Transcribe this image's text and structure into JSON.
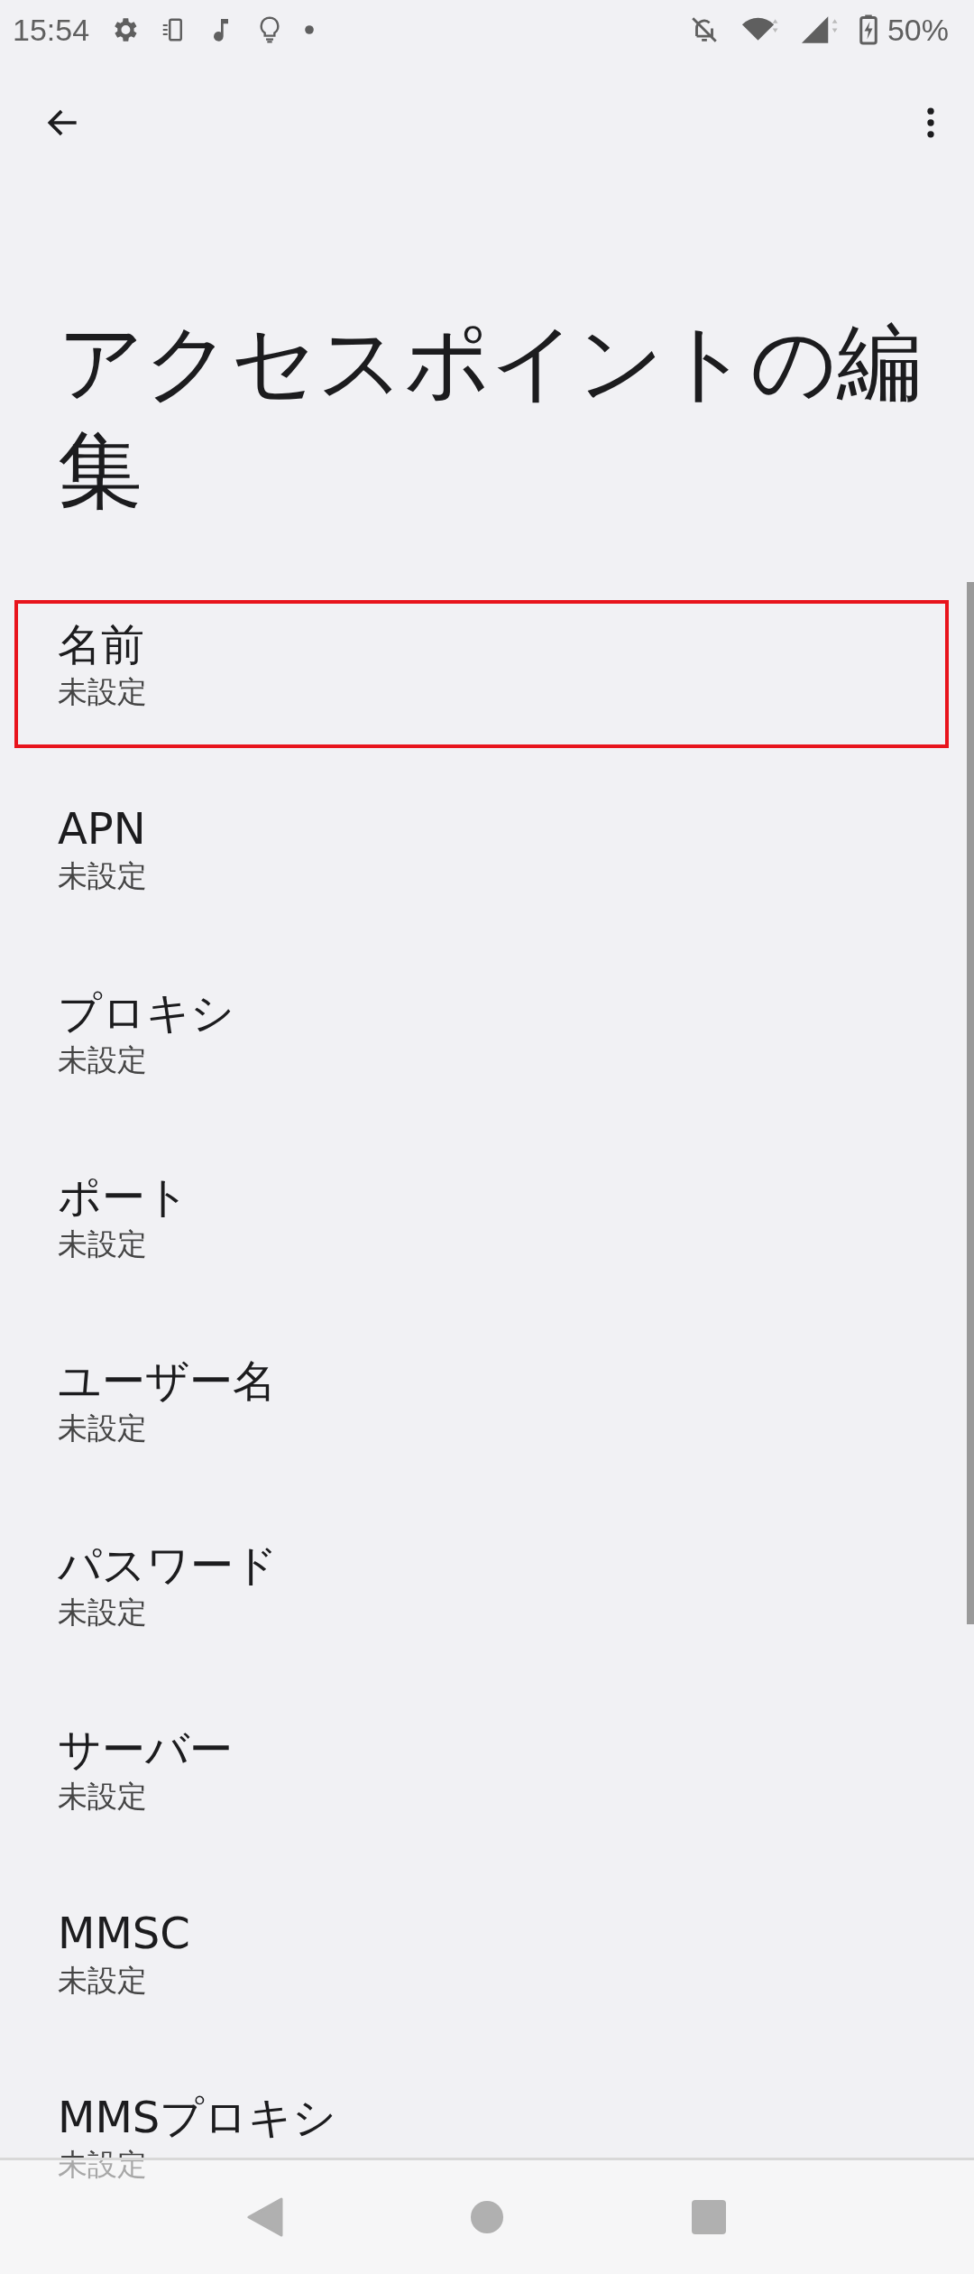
{
  "status_bar": {
    "time": "15:54",
    "battery": "50%"
  },
  "title": "アクセスポイントの編集",
  "settings": [
    {
      "title": "名前",
      "summary": "未設定",
      "highlighted": true
    },
    {
      "title": "APN",
      "summary": "未設定",
      "highlighted": false
    },
    {
      "title": "プロキシ",
      "summary": "未設定",
      "highlighted": false
    },
    {
      "title": "ポート",
      "summary": "未設定",
      "highlighted": false
    },
    {
      "title": "ユーザー名",
      "summary": "未設定",
      "highlighted": false
    },
    {
      "title": "パスワード",
      "summary": "未設定",
      "highlighted": false
    },
    {
      "title": "サーバー",
      "summary": "未設定",
      "highlighted": false
    },
    {
      "title": "MMSC",
      "summary": "未設定",
      "highlighted": false
    },
    {
      "title": "MMSプロキシ",
      "summary": "未設定",
      "highlighted": false
    }
  ]
}
